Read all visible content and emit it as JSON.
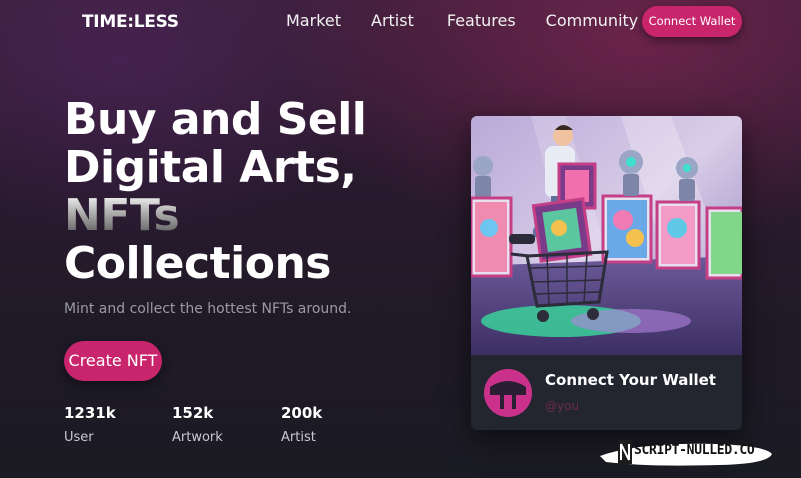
{
  "brand": {
    "logo": "TIME:LESS"
  },
  "nav": {
    "links": [
      "Market",
      "Artist",
      "Features",
      "Community"
    ],
    "connect_label": "Connect Wallet"
  },
  "hero": {
    "title_lines": [
      "Buy and Sell",
      "Digital Arts,",
      "NFTs",
      "Collections"
    ],
    "subtitle": "Mint and collect the hottest NFTs around.",
    "cta_label": "Create NFT",
    "stats": [
      {
        "value": "1231k",
        "label": "User"
      },
      {
        "value": "152k",
        "label": "Artwork"
      },
      {
        "value": "200k",
        "label": "Artist"
      }
    ]
  },
  "card": {
    "title": "Connect Your Wallet",
    "handle": "@you"
  },
  "watermark": {
    "text": "SCRIPT-NULLED.CO"
  },
  "colors": {
    "accent": "#c8256c",
    "card_bg": "#23262f",
    "avatar": "#c9318a"
  },
  "icons": {
    "avatar": "avatar-logo-icon",
    "card_art": "nft-shopping-illustration"
  }
}
